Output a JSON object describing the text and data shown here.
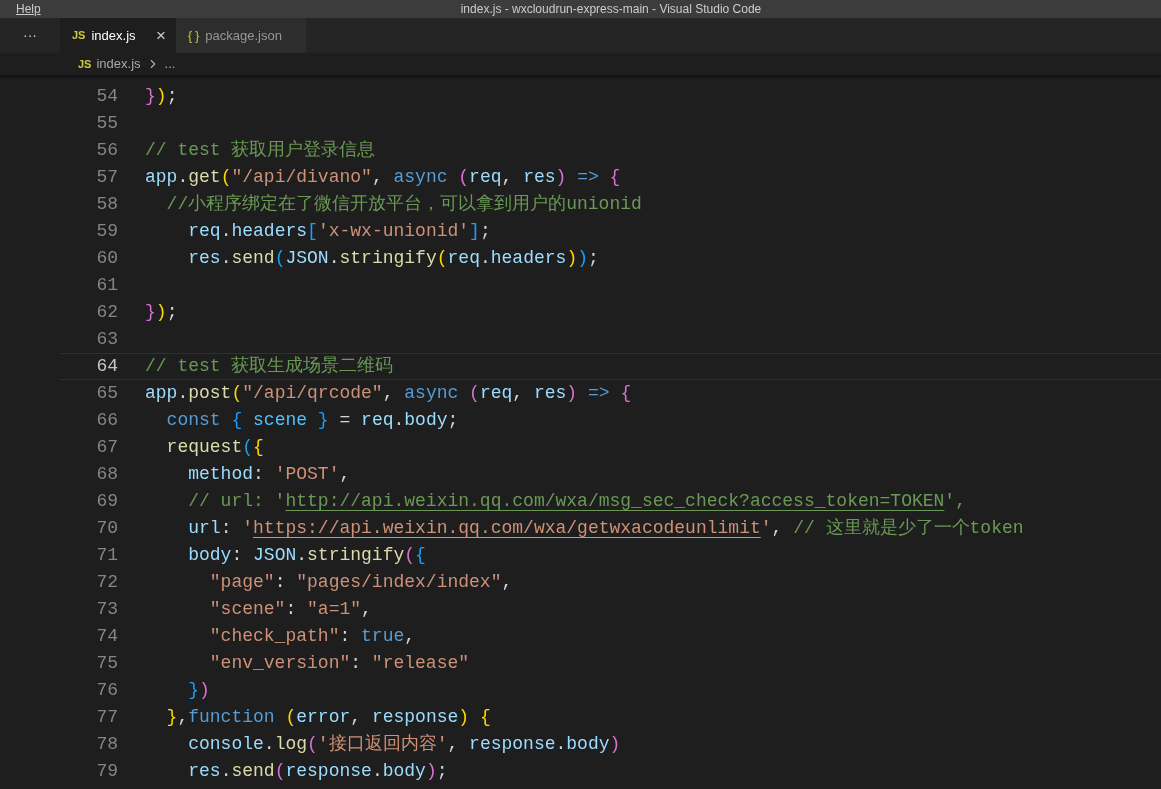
{
  "menu": {
    "label": "Help"
  },
  "window": {
    "title": "index.js - wxcloudrun-express-main - Visual Studio Code"
  },
  "more_actions": "···",
  "tabs": [
    {
      "badge": "JS",
      "kind": "script",
      "label": "index.js",
      "selected": true,
      "close": "×"
    },
    {
      "badge": "{ }",
      "kind": "json",
      "label": "package.json",
      "selected": false
    }
  ],
  "breadcrumb": {
    "badge": "JS",
    "file": "index.js",
    "rest": "..."
  },
  "lines": [
    {
      "number": "54",
      "current": false,
      "tokens": [
        {
          "t": "}",
          "kind": "bracket2"
        },
        {
          "t": ")",
          "kind": "bracket1"
        },
        {
          "t": ";",
          "kind": "plain"
        }
      ]
    },
    {
      "number": "55",
      "current": false
    },
    {
      "number": "56",
      "current": false,
      "tokens": [
        {
          "t": "// test 获取用户登录信息",
          "kind": "comment"
        }
      ]
    },
    {
      "number": "57",
      "current": false,
      "tokens": [
        {
          "t": "app",
          "kind": "variable"
        },
        {
          "t": ".",
          "kind": "plain"
        },
        {
          "t": "get",
          "kind": "function"
        },
        {
          "t": "(",
          "kind": "bracket1"
        },
        {
          "t": "\"/api/divano\"",
          "kind": "string"
        },
        {
          "t": ", ",
          "kind": "plain"
        },
        {
          "t": "async ",
          "kind": "keyword"
        },
        {
          "t": "(",
          "kind": "bracket2"
        },
        {
          "t": "req",
          "kind": "variable"
        },
        {
          "t": ", ",
          "kind": "plain"
        },
        {
          "t": "res",
          "kind": "variable"
        },
        {
          "t": ")",
          "kind": "bracket2"
        },
        {
          "t": " => ",
          "kind": "keyword"
        },
        {
          "t": "{",
          "kind": "bracket2"
        }
      ]
    },
    {
      "number": "58",
      "current": false,
      "tokens": [
        {
          "t": "  //小程序绑定在了微信开放平台，可以拿到用户的unionid",
          "kind": "comment"
        }
      ]
    },
    {
      "number": "59",
      "current": false,
      "tokens": [
        {
          "t": "    req",
          "kind": "variable"
        },
        {
          "t": ".",
          "kind": "plain"
        },
        {
          "t": "headers",
          "kind": "variable"
        },
        {
          "t": "[",
          "kind": "bracket3"
        },
        {
          "t": "'x-wx-unionid'",
          "kind": "string"
        },
        {
          "t": "]",
          "kind": "bracket3"
        },
        {
          "t": ";",
          "kind": "plain"
        }
      ]
    },
    {
      "number": "60",
      "current": false,
      "tokens": [
        {
          "t": "    res",
          "kind": "variable"
        },
        {
          "t": ".",
          "kind": "plain"
        },
        {
          "t": "send",
          "kind": "function"
        },
        {
          "t": "(",
          "kind": "bracket3"
        },
        {
          "t": "JSON",
          "kind": "variable"
        },
        {
          "t": ".",
          "kind": "plain"
        },
        {
          "t": "stringify",
          "kind": "function"
        },
        {
          "t": "(",
          "kind": "bracket1"
        },
        {
          "t": "req",
          "kind": "variable"
        },
        {
          "t": ".",
          "kind": "plain"
        },
        {
          "t": "headers",
          "kind": "variable"
        },
        {
          "t": ")",
          "kind": "bracket1"
        },
        {
          "t": ")",
          "kind": "bracket3"
        },
        {
          "t": ";",
          "kind": "plain"
        }
      ]
    },
    {
      "number": "61",
      "current": false
    },
    {
      "number": "62",
      "current": false,
      "tokens": [
        {
          "t": "}",
          "kind": "bracket2"
        },
        {
          "t": ")",
          "kind": "bracket1"
        },
        {
          "t": ";",
          "kind": "plain"
        }
      ]
    },
    {
      "number": "63",
      "current": false
    },
    {
      "number": "64",
      "current": true,
      "tokens": [
        {
          "t": "// test 获取生成场景二维码",
          "kind": "comment"
        }
      ]
    },
    {
      "number": "65",
      "current": false,
      "tokens": [
        {
          "t": "app",
          "kind": "variable"
        },
        {
          "t": ".",
          "kind": "plain"
        },
        {
          "t": "post",
          "kind": "function"
        },
        {
          "t": "(",
          "kind": "bracket1"
        },
        {
          "t": "\"/api/qrcode\"",
          "kind": "string"
        },
        {
          "t": ", ",
          "kind": "plain"
        },
        {
          "t": "async ",
          "kind": "keyword"
        },
        {
          "t": "(",
          "kind": "bracket2"
        },
        {
          "t": "req",
          "kind": "variable"
        },
        {
          "t": ", ",
          "kind": "plain"
        },
        {
          "t": "res",
          "kind": "variable"
        },
        {
          "t": ")",
          "kind": "bracket2"
        },
        {
          "t": " => ",
          "kind": "keyword"
        },
        {
          "t": "{",
          "kind": "bracket2"
        }
      ]
    },
    {
      "number": "66",
      "current": false,
      "tokens": [
        {
          "t": "  const ",
          "kind": "keyword"
        },
        {
          "t": "{",
          "kind": "bracket3"
        },
        {
          "t": " scene ",
          "kind": "constant"
        },
        {
          "t": "}",
          "kind": "bracket3"
        },
        {
          "t": " = ",
          "kind": "plain"
        },
        {
          "t": "req",
          "kind": "variable"
        },
        {
          "t": ".",
          "kind": "plain"
        },
        {
          "t": "body",
          "kind": "variable"
        },
        {
          "t": ";",
          "kind": "plain"
        }
      ]
    },
    {
      "number": "67",
      "current": false,
      "tokens": [
        {
          "t": "  request",
          "kind": "function"
        },
        {
          "t": "(",
          "kind": "bracket3"
        },
        {
          "t": "{",
          "kind": "bracket1"
        }
      ]
    },
    {
      "number": "68",
      "current": false,
      "tokens": [
        {
          "t": "    method",
          "kind": "variable"
        },
        {
          "t": ": ",
          "kind": "plain"
        },
        {
          "t": "'POST'",
          "kind": "string"
        },
        {
          "t": ",",
          "kind": "plain"
        }
      ]
    },
    {
      "number": "69",
      "current": false,
      "tokens": [
        {
          "t": "    // url: '",
          "kind": "comment"
        },
        {
          "t": "http://api.weixin.qq.com/wxa/msg_sec_check?access_token=TOKEN",
          "kind": "comment_link"
        },
        {
          "t": "',",
          "kind": "comment"
        }
      ]
    },
    {
      "number": "70",
      "current": false,
      "tokens": [
        {
          "t": "    url",
          "kind": "variable"
        },
        {
          "t": ": ",
          "kind": "plain"
        },
        {
          "t": "'",
          "kind": "string"
        },
        {
          "t": "https://api.weixin.qq.com/wxa/getwxacodeunlimit",
          "kind": "string_link"
        },
        {
          "t": "'",
          "kind": "string"
        },
        {
          "t": ", ",
          "kind": "plain"
        },
        {
          "t": "// 这里就是少了一个token",
          "kind": "comment"
        }
      ]
    },
    {
      "number": "71",
      "current": false,
      "tokens": [
        {
          "t": "    body",
          "kind": "variable"
        },
        {
          "t": ": ",
          "kind": "plain"
        },
        {
          "t": "JSON",
          "kind": "variable"
        },
        {
          "t": ".",
          "kind": "plain"
        },
        {
          "t": "stringify",
          "kind": "function"
        },
        {
          "t": "(",
          "kind": "bracket2"
        },
        {
          "t": "{",
          "kind": "bracket3"
        }
      ]
    },
    {
      "number": "72",
      "current": false,
      "tokens": [
        {
          "t": "      \"page\"",
          "kind": "string"
        },
        {
          "t": ": ",
          "kind": "plain"
        },
        {
          "t": "\"pages/index/index\"",
          "kind": "string"
        },
        {
          "t": ",",
          "kind": "plain"
        }
      ]
    },
    {
      "number": "73",
      "current": false,
      "tokens": [
        {
          "t": "      \"scene\"",
          "kind": "string"
        },
        {
          "t": ": ",
          "kind": "plain"
        },
        {
          "t": "\"a=1\"",
          "kind": "string"
        },
        {
          "t": ",",
          "kind": "plain"
        }
      ]
    },
    {
      "number": "74",
      "current": false,
      "tokens": [
        {
          "t": "      \"check_path\"",
          "kind": "string"
        },
        {
          "t": ": ",
          "kind": "plain"
        },
        {
          "t": "true",
          "kind": "keyword"
        },
        {
          "t": ",",
          "kind": "plain"
        }
      ]
    },
    {
      "number": "75",
      "current": false,
      "tokens": [
        {
          "t": "      \"env_version\"",
          "kind": "string"
        },
        {
          "t": ": ",
          "kind": "plain"
        },
        {
          "t": "\"release\"",
          "kind": "string"
        }
      ]
    },
    {
      "number": "76",
      "current": false,
      "tokens": [
        {
          "t": "    }",
          "kind": "bracket3"
        },
        {
          "t": ")",
          "kind": "bracket2"
        }
      ]
    },
    {
      "number": "77",
      "current": false,
      "tokens": [
        {
          "t": "  }",
          "kind": "bracket1"
        },
        {
          "t": ",",
          "kind": "plain"
        },
        {
          "t": "function ",
          "kind": "keyword"
        },
        {
          "t": "(",
          "kind": "bracket1"
        },
        {
          "t": "error",
          "kind": "variable"
        },
        {
          "t": ", ",
          "kind": "plain"
        },
        {
          "t": "response",
          "kind": "variable"
        },
        {
          "t": ") ",
          "kind": "bracket1"
        },
        {
          "t": "{",
          "kind": "bracket1"
        }
      ]
    },
    {
      "number": "78",
      "current": false,
      "tokens": [
        {
          "t": "    console",
          "kind": "variable"
        },
        {
          "t": ".",
          "kind": "plain"
        },
        {
          "t": "log",
          "kind": "function"
        },
        {
          "t": "(",
          "kind": "bracket2"
        },
        {
          "t": "'接口返回内容'",
          "kind": "string"
        },
        {
          "t": ", ",
          "kind": "plain"
        },
        {
          "t": "response",
          "kind": "variable"
        },
        {
          "t": ".",
          "kind": "plain"
        },
        {
          "t": "body",
          "kind": "variable"
        },
        {
          "t": ")",
          "kind": "bracket2"
        }
      ]
    },
    {
      "number": "79",
      "current": false,
      "tokens": [
        {
          "t": "    res",
          "kind": "variable"
        },
        {
          "t": ".",
          "kind": "plain"
        },
        {
          "t": "send",
          "kind": "function"
        },
        {
          "t": "(",
          "kind": "bracket2"
        },
        {
          "t": "response",
          "kind": "variable"
        },
        {
          "t": ".",
          "kind": "plain"
        },
        {
          "t": "body",
          "kind": "variable"
        },
        {
          "t": ")",
          "kind": "bracket2"
        },
        {
          "t": ";",
          "kind": "plain"
        }
      ]
    }
  ]
}
